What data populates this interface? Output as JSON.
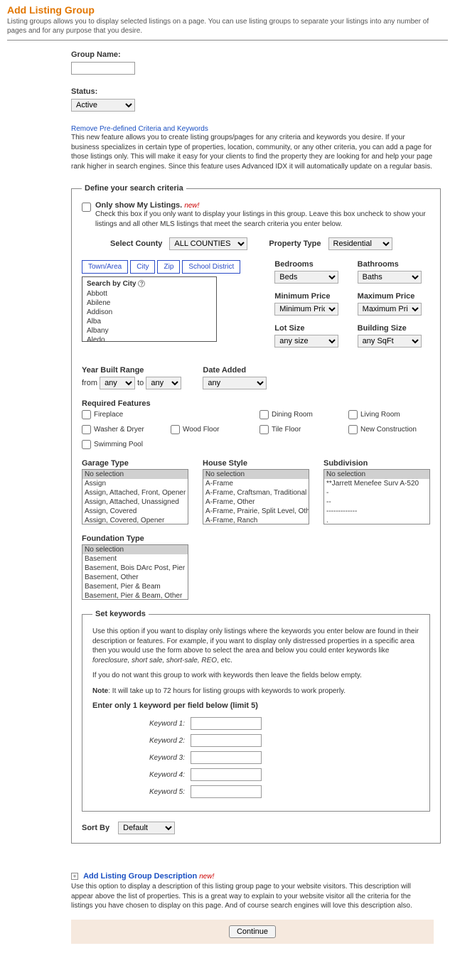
{
  "page": {
    "title": "Add Listing Group",
    "subtitle": "Listing groups allows you to display selected listings on a page. You can use listing groups to separate your listings into any number of pages and for any purpose that you desire."
  },
  "group_name": {
    "label": "Group Name:"
  },
  "status": {
    "label": "Status:",
    "value": "Active"
  },
  "criteria_intro": {
    "link": "Remove Pre-defined Criteria and Keywords",
    "text": "This new feature allows you to create listing groups/pages for any criteria and keywords you desire. If your business specializes in certain type of properties, location, community, or any other criteria, you can add a page for those listings only. This will make it easy for your clients to find the property they are looking for and help your page rank higher in search engines. Since this feature uses Advanced IDX it will automatically update on a regular basis."
  },
  "criteria": {
    "legend": "Define your search criteria",
    "only_mine_label": "Only show My Listings.",
    "new_tag": "new!",
    "only_mine_help": "Check this box if you only want to display your listings in this group. Leave this box uncheck to show your listings and all other MLS listings that meet the search criteria you enter below.",
    "select_county_label": "Select County",
    "select_county_value": "ALL COUNTIES",
    "property_type_label": "Property Type",
    "property_type_value": "Residential",
    "tabs": {
      "town": "Town/Area",
      "city": "City",
      "zip": "Zip",
      "school": "School District"
    },
    "search_by_city": "Search by City",
    "cities": [
      "Abbott",
      "Abilene",
      "Addison",
      "Alba",
      "Albany",
      "Aledo"
    ],
    "bedrooms_label": "Bedrooms",
    "bedrooms_value": "Beds",
    "bathrooms_label": "Bathrooms",
    "bathrooms_value": "Baths",
    "min_price_label": "Minimum Price",
    "min_price_value": "Minimum Price",
    "max_price_label": "Maximum Price",
    "max_price_value": "Maximum Price",
    "lot_size_label": "Lot Size",
    "lot_size_value": "any size",
    "building_size_label": "Building Size",
    "building_size_value": "any SqFt",
    "year_built_label": "Year Built Range",
    "from_label": "from",
    "to_label": "to",
    "any_value": "any",
    "date_added_label": "Date Added",
    "date_added_value": "any",
    "required_features_label": "Required Features",
    "features": [
      "Fireplace",
      "Dining Room",
      "Living Room",
      "Washer & Dryer",
      "Wood Floor",
      "Tile Floor",
      "New Construction",
      "Swimming Pool"
    ],
    "garage_type_label": "Garage Type",
    "garage_type": [
      "No selection",
      "Assign",
      "Assign, Attached, Front, Opener",
      "Assign, Attached, Unassigned",
      "Assign, Covered",
      "Assign, Covered, Opener"
    ],
    "house_style_label": "House Style",
    "house_style": [
      "No selection",
      "A-Frame",
      "A-Frame, Craftsman, Traditional",
      "A-Frame, Other",
      "A-Frame, Prairie, Split Level, Other",
      "A-Frame, Ranch"
    ],
    "subdivision_label": "Subdivision",
    "subdivision": [
      "No selection",
      "**Jarrett Menefee Surv A-520",
      "-",
      "--",
      "-------------",
      "."
    ],
    "foundation_type_label": "Foundation Type",
    "foundation_type": [
      "No selection",
      "Basement",
      "Basement, Bois DArc Post, Pier",
      "Basement, Other",
      "Basement, Pier & Beam",
      "Basement, Pier & Beam, Other"
    ]
  },
  "keywords": {
    "legend": "Set keywords",
    "help1": "Use this option if you want to display only listings where the keywords you enter below are found in their description or features. For example, if you want to display only distressed properties in a specific area then you would use the form above to select the area and below you could enter keywords like ",
    "help1_em": "foreclosure, short sale, short-sale, REO",
    "help1_end": ", etc.",
    "help2": "If you do not want this group to work with keywords then leave the fields below empty.",
    "note_label": "Note",
    "note_text": ": It will take up to 72 hours for listing groups with keywords to work properly.",
    "instruction": "Enter only 1 keyword per field below (limit 5)",
    "labels": [
      "Keyword 1:",
      "Keyword 2:",
      "Keyword 3:",
      "Keyword 4:",
      "Keyword 5:"
    ]
  },
  "sort_by": {
    "label": "Sort By",
    "value": "Default"
  },
  "description": {
    "toggle": "Add Listing Group Description",
    "new_tag": "new!",
    "text": "Use this option to display a description of this listing group page to your website visitors. This description will appear above the list of properties. This is a great way to explain to your website visitor all the criteria for the listings you have chosen to display on this page. And of course search engines will love this description also."
  },
  "continue_label": "Continue"
}
